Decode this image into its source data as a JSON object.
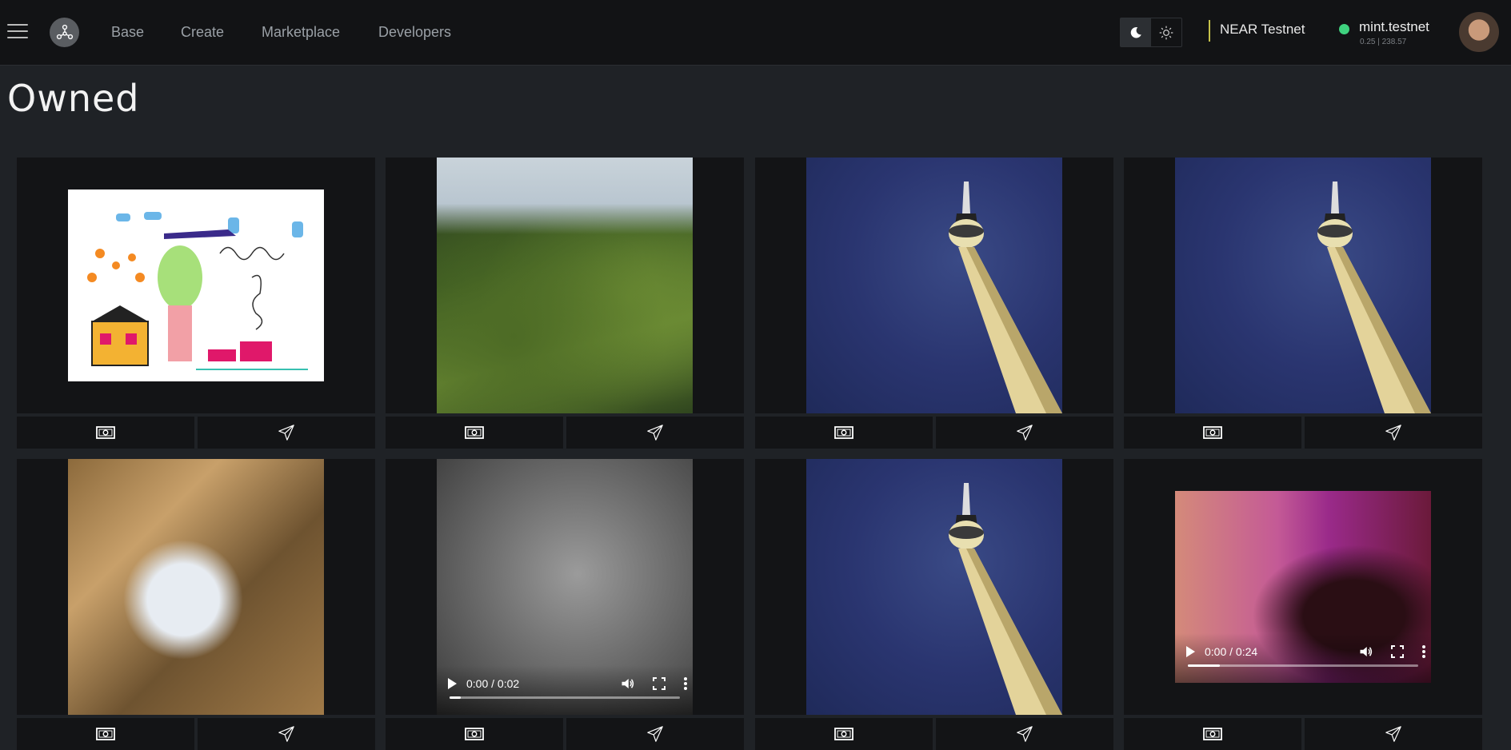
{
  "nav": {
    "links": [
      "Base",
      "Create",
      "Marketplace",
      "Developers"
    ],
    "network": "NEAR Testnet",
    "account": "mint.testnet",
    "balance": "0.25 | 238.57",
    "status_color": "#3fd27f",
    "accent_color": "#c6c24a"
  },
  "page": {
    "title": "Owned"
  },
  "tokens": [
    {
      "art": "kids-drawing",
      "media": "image"
    },
    {
      "art": "mountain-valley",
      "media": "image"
    },
    {
      "art": "tv-tower",
      "media": "image"
    },
    {
      "art": "tv-tower",
      "media": "image"
    },
    {
      "art": "cat-in-window",
      "media": "image"
    },
    {
      "art": "face-closeup",
      "media": "video",
      "time": "0:00 / 0:02",
      "progress": 0.05
    },
    {
      "art": "tv-tower",
      "media": "image"
    },
    {
      "art": "palm-trees",
      "media": "video",
      "time": "0:00 / 0:24",
      "progress": 0.14
    }
  ],
  "icons": {
    "sell": "money-icon",
    "transfer": "send-icon"
  }
}
